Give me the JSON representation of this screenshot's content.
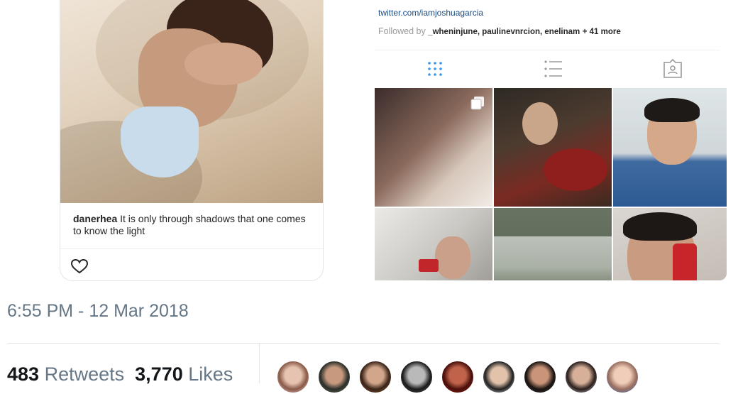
{
  "post": {
    "username": "danerhea",
    "caption": "It is only through shadows that one comes to know the light"
  },
  "profile": {
    "twitter_link": "twitter.com/iamjoshuagarcia",
    "followed_by_label": "Followed by",
    "followed_names": "_wheninjune, paulinevnrcion, enelinam",
    "followed_more": "+ 41 more"
  },
  "tweet": {
    "timestamp": "6:55 PM - 12 Mar 2018",
    "retweets_count": "483",
    "retweets_label": "Retweets",
    "likes_count": "3,770",
    "likes_label": "Likes"
  },
  "icons": {
    "heart": "heart-outline-icon",
    "grid": "grid-icon",
    "list": "list-icon",
    "tagged": "tagged-icon",
    "multi": "multiple-photos-icon"
  },
  "colors": {
    "timestamp": "#657786",
    "link": "#1b4d83",
    "active_tab": "#3897f0"
  }
}
